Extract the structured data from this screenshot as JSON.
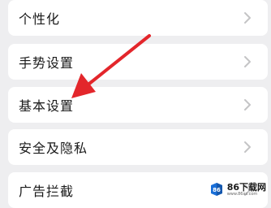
{
  "menu": {
    "items": [
      {
        "label": "个性化",
        "icon": "chevron-right-icon"
      },
      {
        "label": "手势设置",
        "icon": "chevron-right-icon"
      },
      {
        "label": "基本设置",
        "icon": "chevron-right-icon"
      },
      {
        "label": "安全及隐私",
        "icon": "chevron-right-icon"
      },
      {
        "label": "广告拦截",
        "icon": "chevron-right-icon"
      }
    ]
  },
  "annotation": {
    "icon": "red-arrow-icon",
    "color": "#e3262b",
    "points_to": "基本设置"
  },
  "watermark": {
    "title": "86下载网",
    "subtitle": "www.86xz.com",
    "logo_color": "#1a6fd8"
  },
  "colors": {
    "background": "#eeeef0",
    "row_background": "#ffffff",
    "label": "#1a1a1a",
    "chevron": "#c4c4c6"
  }
}
